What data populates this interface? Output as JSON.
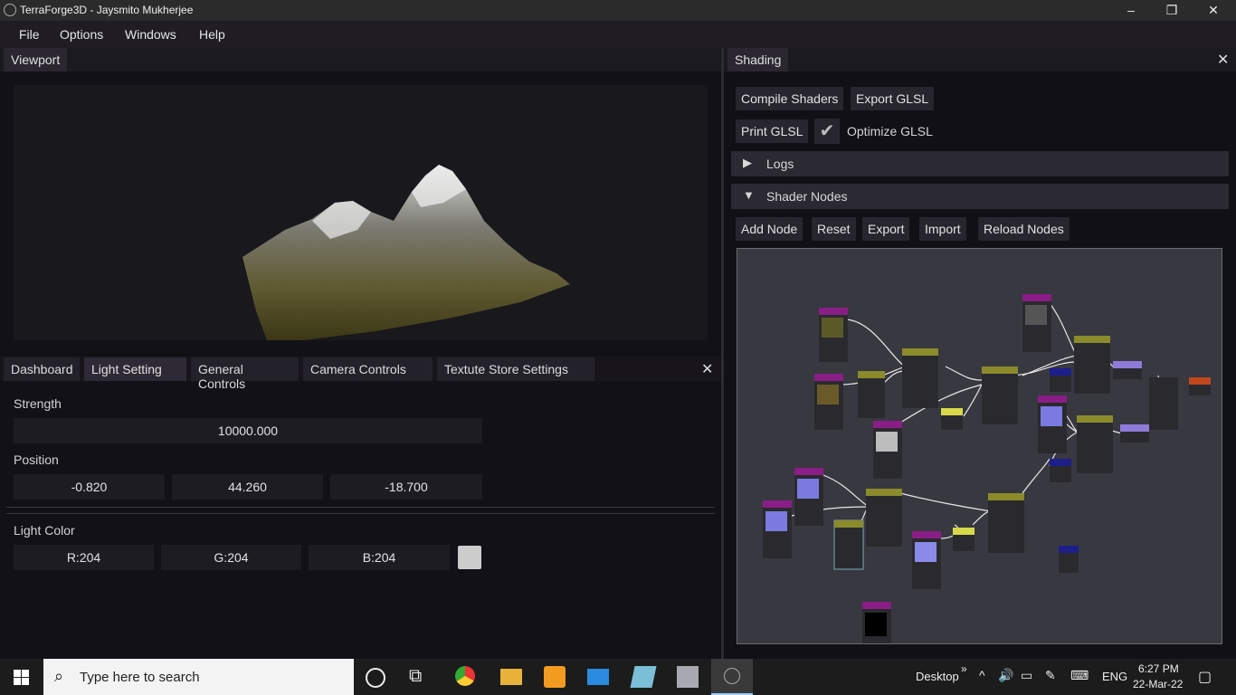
{
  "window": {
    "title": "TerraForge3D - Jaysmito Mukherjee",
    "controls": [
      "–",
      "❐",
      "✕"
    ]
  },
  "menu": [
    "File",
    "Options",
    "Windows",
    "Help"
  ],
  "viewport": {
    "tab": "Viewport"
  },
  "bottom_tabs": {
    "tabs": [
      "Dashboard",
      "Light Setting",
      "General Controls",
      "Camera Controls",
      "Textute Store Settings"
    ],
    "active": "Light Setting",
    "close": "✕"
  },
  "light": {
    "strength_label": "Strength",
    "strength": "10000.000",
    "position_label": "Position",
    "position": [
      "-0.820",
      "44.260",
      "-18.700"
    ],
    "color_label": "Light Color",
    "color": [
      "R:204",
      "G:204",
      "B:204"
    ],
    "swatch": "#cccccc"
  },
  "shading": {
    "title": "Shading",
    "close": "✕",
    "buttons": [
      "Compile Shaders",
      "Export GLSL",
      "Print GLSL"
    ],
    "optimize_label": "Optimize GLSL",
    "optimize_checked": true,
    "logs": "Logs",
    "shader_nodes": "Shader Nodes",
    "node_buttons": [
      "Add Node",
      "Reset",
      "Export",
      "Import",
      "Reload Nodes"
    ]
  },
  "taskbar": {
    "search_placeholder": "Type here to search",
    "desktop": "Desktop",
    "language": "ENG",
    "time": "6:27 PM",
    "date": "22-Mar-22"
  },
  "colors": {
    "node_magenta": "#8a1d86",
    "node_olive": "#8b8b2c",
    "node_yellow": "#d8d84a",
    "node_violet": "#8f7bd9",
    "node_navy": "#1e1e8a",
    "node_orange": "#c2461c",
    "node_body": "#2a2a2e",
    "editor_bg": "#383840"
  }
}
